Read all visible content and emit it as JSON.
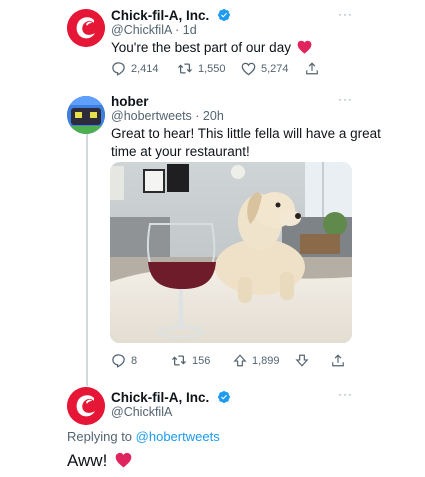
{
  "tweet1": {
    "name": "Chick-fil-A, Inc.",
    "handle": "@ChickfilA",
    "time": "1d",
    "text": "You're the best part of our day",
    "replies": "2,414",
    "retweets": "1,550",
    "likes": "5,274"
  },
  "tweet2": {
    "name": "hober",
    "handle": "@hobertweets",
    "time": "20h",
    "text_line1": "Great to hear! This little fella will have a great",
    "text_line2": "time at your restaurant!",
    "replies": "8",
    "retweets": "156",
    "likes": "1,899"
  },
  "tweet3": {
    "name": "Chick-fil-A, Inc.",
    "handle": "@ChickfilA",
    "replying_prefix": "Replying to",
    "replying_to": "@hobertweets",
    "text": "Aww!"
  },
  "colors": {
    "accent": "#1d9bf0",
    "brand_red": "#e51636",
    "muted": "#536471"
  },
  "icons": [
    "reply-icon",
    "retweet-icon",
    "like-icon",
    "share-icon",
    "upvote-icon",
    "downvote-icon",
    "verified-icon",
    "heart-emoji",
    "more-icon"
  ]
}
